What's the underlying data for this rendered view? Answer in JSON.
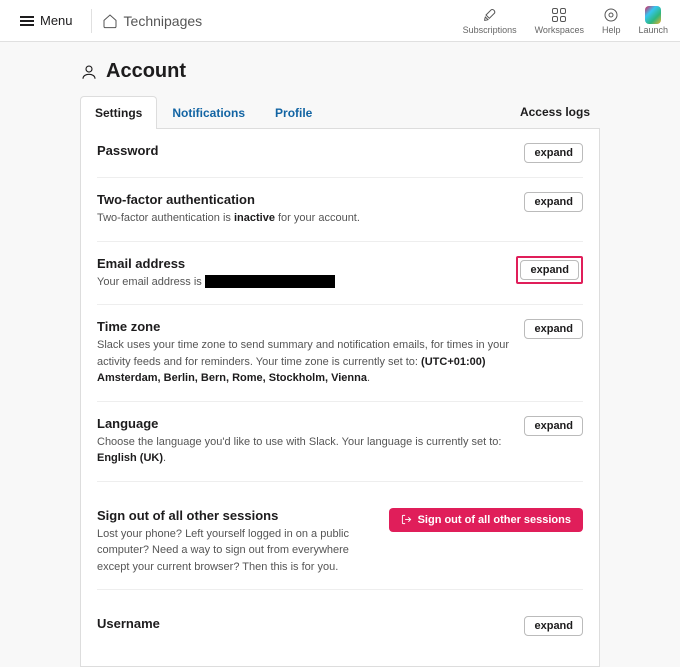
{
  "topbar": {
    "menu_label": "Menu",
    "brand": "Technipages",
    "items": [
      {
        "label": "Subscriptions"
      },
      {
        "label": "Workspaces"
      },
      {
        "label": "Help"
      },
      {
        "label": "Launch"
      }
    ]
  },
  "page": {
    "title": "Account"
  },
  "tabs": [
    {
      "label": "Settings",
      "active": true
    },
    {
      "label": "Notifications",
      "active": false
    },
    {
      "label": "Profile",
      "active": false
    }
  ],
  "tabs_right": "Access logs",
  "sections": {
    "password": {
      "title": "Password",
      "expand": "expand"
    },
    "twofa": {
      "title": "Two-factor authentication",
      "desc_pre": "Two-factor authentication is ",
      "desc_bold": "inactive",
      "desc_post": " for your account.",
      "expand": "expand"
    },
    "email": {
      "title": "Email address",
      "desc_pre": "Your email address is ",
      "expand": "expand"
    },
    "timezone": {
      "title": "Time zone",
      "desc_pre": "Slack uses your time zone to send summary and notification emails, for times in your activity feeds and for reminders. Your time zone is currently set to: ",
      "desc_bold": "(UTC+01:00) Amsterdam, Berlin, Bern, Rome, Stockholm, Vienna",
      "desc_post": ".",
      "expand": "expand"
    },
    "language": {
      "title": "Language",
      "desc_pre": "Choose the language you'd like to use with Slack. Your language is currently set to: ",
      "desc_bold": "English (UK)",
      "desc_post": ".",
      "expand": "expand"
    },
    "signout": {
      "title": "Sign out of all other sessions",
      "desc": "Lost your phone? Left yourself logged in on a public computer? Need a way to sign out from everywhere except your current browser? Then this is for you.",
      "button": "Sign out of all other sessions"
    },
    "username": {
      "title": "Username",
      "expand": "expand"
    }
  }
}
